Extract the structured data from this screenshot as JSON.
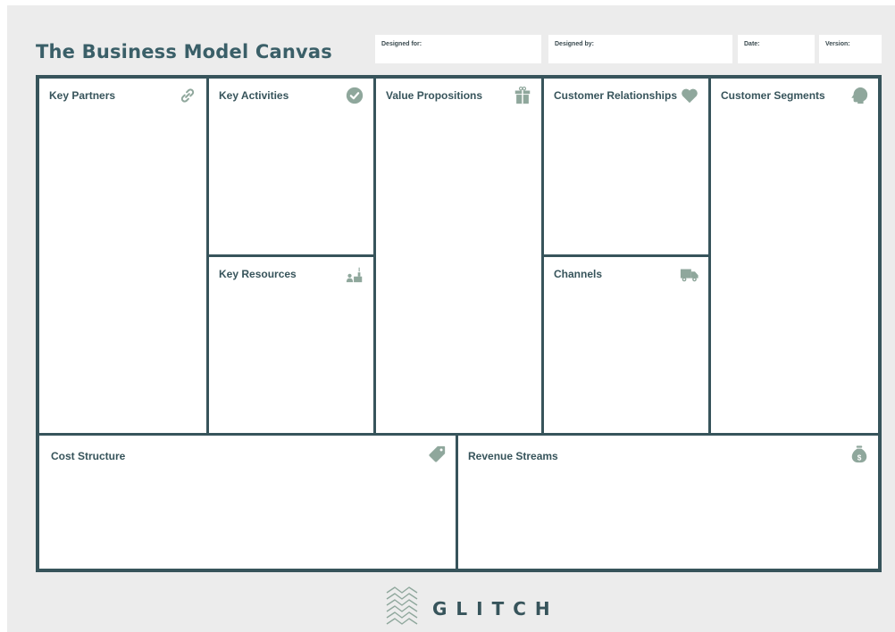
{
  "canvas": {
    "title": "The Business Model Canvas"
  },
  "meta": {
    "designed_for_label": "Designed for:",
    "designed_by_label": "Designed by:",
    "date_label": "Date:",
    "version_label": "Version:"
  },
  "blocks": {
    "key_partners": {
      "label": "Key Partners",
      "icon": "link-icon"
    },
    "key_activities": {
      "label": "Key Activities",
      "icon": "check-circle-icon"
    },
    "key_resources": {
      "label": "Key Resources",
      "icon": "resources-icon"
    },
    "value_propositions": {
      "label": "Value Propositions",
      "icon": "gift-icon"
    },
    "customer_relationships": {
      "label": "Customer Relationships",
      "icon": "heart-icon"
    },
    "channels": {
      "label": "Channels",
      "icon": "truck-icon"
    },
    "customer_segments": {
      "label": "Customer Segments",
      "icon": "head-icon"
    },
    "cost_structure": {
      "label": "Cost Structure",
      "icon": "price-tag-icon"
    },
    "revenue_streams": {
      "label": "Revenue Streams",
      "icon": "money-bag-icon"
    }
  },
  "footer": {
    "brand": "GLITCH",
    "logo_icon": "chevron-stack-logo"
  },
  "colors": {
    "frame": "#37545b",
    "icon": "#8fa79c",
    "title": "#3a5f68",
    "background": "#ececec"
  }
}
